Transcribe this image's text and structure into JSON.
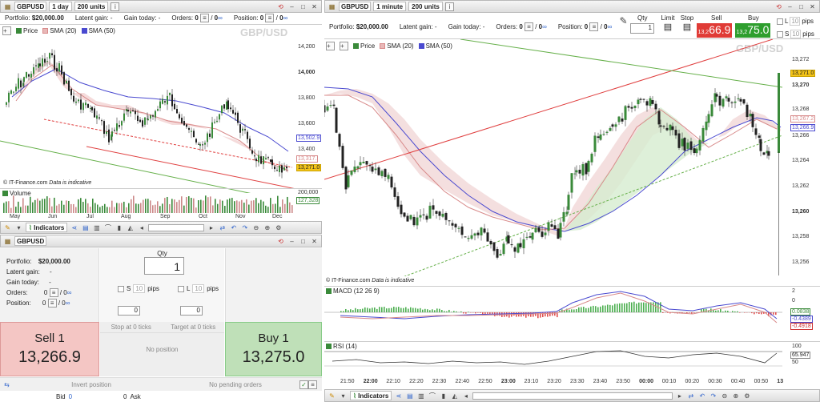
{
  "left_window": {
    "toolbar": {
      "symbol": "GBPUSD",
      "timeframe": "1 day",
      "units": "200 units"
    },
    "info": {
      "portfolio_label": "Portfolio:",
      "portfolio_value": "$20,000.00",
      "latent_label": "Latent gain:",
      "latent_value": "-",
      "today_label": "Gain today:",
      "today_value": "-",
      "orders_label": "Orders:",
      "orders_value": "0",
      "orders_count": "0",
      "position_label": "Position:",
      "position_value": "0",
      "position_count": "0"
    },
    "chart": {
      "watermark": "GBP/USD",
      "legend": {
        "price": "Price",
        "sma20": "SMA (20)",
        "sma50": "SMA (50)"
      },
      "credit": "© IT-Finance.com",
      "credit_note": "Data is indicative",
      "y_ticks": [
        "14,200",
        "14,000",
        "13,800",
        "13,600",
        "13,400"
      ],
      "tag_sma50": "13,502.9",
      "tag_sma20": "13,317.",
      "tag_last": "13,271.0",
      "volume_label": "Volume",
      "volume_ticks": [
        "200,000"
      ],
      "volume_tag": "127,328",
      "x_ticks": [
        "May",
        "Jun",
        "Jul",
        "Aug",
        "Sep",
        "Oct",
        "Nov",
        "Dec"
      ]
    },
    "bottom_toolbar": {
      "indicators": "Indicators"
    }
  },
  "order_panel": {
    "symbol": "GBPUSD",
    "portfolio_label": "Portfolio:",
    "portfolio_value": "$20,000.00",
    "latent_label": "Latent gain:",
    "latent_value": "-",
    "today_label": "Gain today:",
    "today_value": "-",
    "orders_label": "Orders:",
    "orders_value": "0",
    "orders_count": "0",
    "position_label": "Position:",
    "position_value": "0",
    "position_count": "0",
    "qty_label": "Qty",
    "qty_value": "1",
    "s_label": "S",
    "s_value": "10",
    "l_label": "L",
    "l_value": "10",
    "pips": "pips",
    "stop_value": "0",
    "target_value": "0",
    "sell_label": "Sell 1",
    "sell_price": "13,266.9",
    "buy_label": "Buy 1",
    "buy_price": "13,275.0",
    "stop_at": "Stop at 0 ticks",
    "target_at": "Target at 0 ticks",
    "no_position": "No position",
    "invert_position": "Invert position",
    "no_pending": "No pending orders",
    "bid_label": "Bid",
    "bid_value": "0",
    "ask_label": "Ask",
    "ask_value": "0"
  },
  "right_window": {
    "toolbar": {
      "symbol": "GBPUSD",
      "timeframe": "1 minute",
      "units": "200 units"
    },
    "info": {
      "portfolio_label": "Portfolio:",
      "portfolio_value": "$20,000.00",
      "latent_label": "Latent gain:",
      "latent_value": "-",
      "today_label": "Gain today:",
      "today_value": "-",
      "orders_label": "Orders:",
      "orders_value": "0",
      "orders_count": "0",
      "position_label": "Position:",
      "position_value": "0",
      "position_count": "0"
    },
    "trade": {
      "qty_label": "Qty",
      "qty_value": "1",
      "limit": "Limit",
      "stop": "Stop",
      "sell_label": "Sell",
      "sell_small": "13,2",
      "sell_big": "66.9",
      "buy_label": "Buy",
      "buy_small": "13,2",
      "buy_big": "75.0",
      "l_label": "L",
      "l_value": "10",
      "s_label": "S",
      "s_value": "10",
      "pips": "pips"
    },
    "chart": {
      "watermark": "GBP/USD",
      "legend": {
        "price": "Price",
        "sma20": "SMA (20)",
        "sma50": "SMA (50)"
      },
      "credit": "© IT-Finance.com",
      "credit_note": "Data is indicative",
      "y_ticks": [
        "13,272",
        "13,270",
        "13,268",
        "13,266",
        "13,264",
        "13,262",
        "13,260",
        "13,258",
        "13,256"
      ],
      "tag_last": "13,271.0",
      "tag_sma20": "13,267.2",
      "tag_sma50": "13,266.9",
      "macd_label": "MACD (12 26 9)",
      "macd_ticks": [
        "2",
        "0"
      ],
      "macd_tag1": "0.0838",
      "macd_tag2": "-0.4389",
      "macd_tag3": "-0.4918",
      "rsi_label": "RSI (14)",
      "rsi_ticks": [
        "100",
        "50"
      ],
      "rsi_tag": "65.947",
      "x_ticks": [
        "21:50",
        "22:00",
        "22:10",
        "22:20",
        "22:30",
        "22:40",
        "22:50",
        "23:00",
        "23:10",
        "23:20",
        "23:30",
        "23:40",
        "23:50",
        "00:00",
        "00:10",
        "00:20",
        "00:30",
        "00:40",
        "00:50",
        "13"
      ]
    },
    "bottom_toolbar": {
      "indicators": "Indicators"
    }
  },
  "colors": {
    "sell_bg": "#f4c6c4",
    "buy_bg": "#bfe0b8",
    "sell_btn": "#e03b36",
    "buy_btn": "#2e9e2e",
    "sma20": "#d88a8a",
    "sma50": "#4a4ad0",
    "trend_red": "#e04040",
    "trend_green": "#66b04a"
  }
}
